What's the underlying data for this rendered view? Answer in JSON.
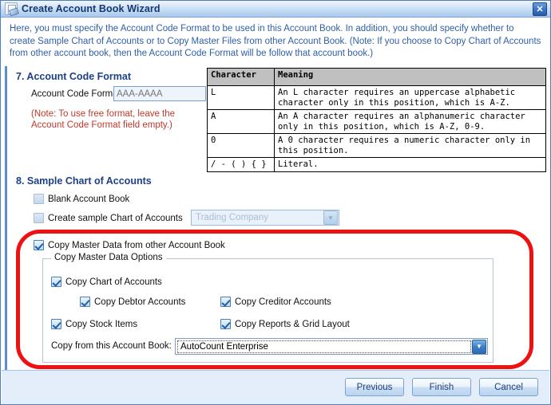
{
  "window": {
    "title": "Create Account Book Wizard",
    "icon": "wizard-document-icon",
    "close_label": "✕"
  },
  "banner": {
    "text": "Here, you must specify the Account Code Format to be used in this Account Book. In addition, you should specify whether to create Sample Chart of Accounts or to Copy Master Files from other Account Book. (Note:  If you choose to Copy Chart of Accounts from other account book, then the Account Code Format will be follow that account book.)"
  },
  "step7": {
    "title": "7. Account Code Format",
    "field_label": "Account Code Format:",
    "field_value": "",
    "field_placeholder": "AAA-AAAA",
    "note": "(Note: To use free format, leave the Account Code Format field empty.)"
  },
  "char_table": {
    "headers": [
      "Character",
      "Meaning"
    ],
    "rows": [
      {
        "character": "L",
        "meaning": "An L character requires an uppercase alphabetic character only in this position, which is A-Z."
      },
      {
        "character": "A",
        "meaning": "An A character requires an alphanumeric character only in this position, which is A-Z, 0-9."
      },
      {
        "character": "0",
        "meaning": "A 0 character requires a numeric character only in this position."
      },
      {
        "character": "/ - ( ) { }",
        "meaning": "Literal."
      }
    ]
  },
  "step8": {
    "title": "8. Sample Chart of Accounts",
    "blank_account_book": {
      "label": "Blank Account Book",
      "checked": false
    },
    "create_sample": {
      "label": "Create sample Chart of Accounts",
      "checked": false
    },
    "sample_combo": {
      "value": "Trading Company",
      "enabled": false,
      "arrow_icon": "chevron-down-icon"
    },
    "copy_master": {
      "label": "Copy Master Data from other Account Book",
      "checked": true
    }
  },
  "copy_options": {
    "legend": "Copy Master Data Options",
    "items": [
      {
        "label": "Copy Chart of Accounts",
        "checked": true
      },
      {
        "label": "Copy Debtor Accounts",
        "checked": true
      },
      {
        "label": "Copy Creditor Accounts",
        "checked": true
      },
      {
        "label": "Copy Stock Items",
        "checked": true
      },
      {
        "label": "Copy Reports & Grid Layout",
        "checked": true
      }
    ],
    "copy_from_label": "Copy from this Account Book:",
    "copy_from_value": "AutoCount Enterprise",
    "copy_from_arrow_icon": "chevron-down-icon"
  },
  "footer": {
    "previous": "Previous",
    "finish": "Finish",
    "cancel": "Cancel"
  },
  "annotation": {
    "highlight_color": "#ee1111",
    "shape": "rounded-rectangle"
  }
}
